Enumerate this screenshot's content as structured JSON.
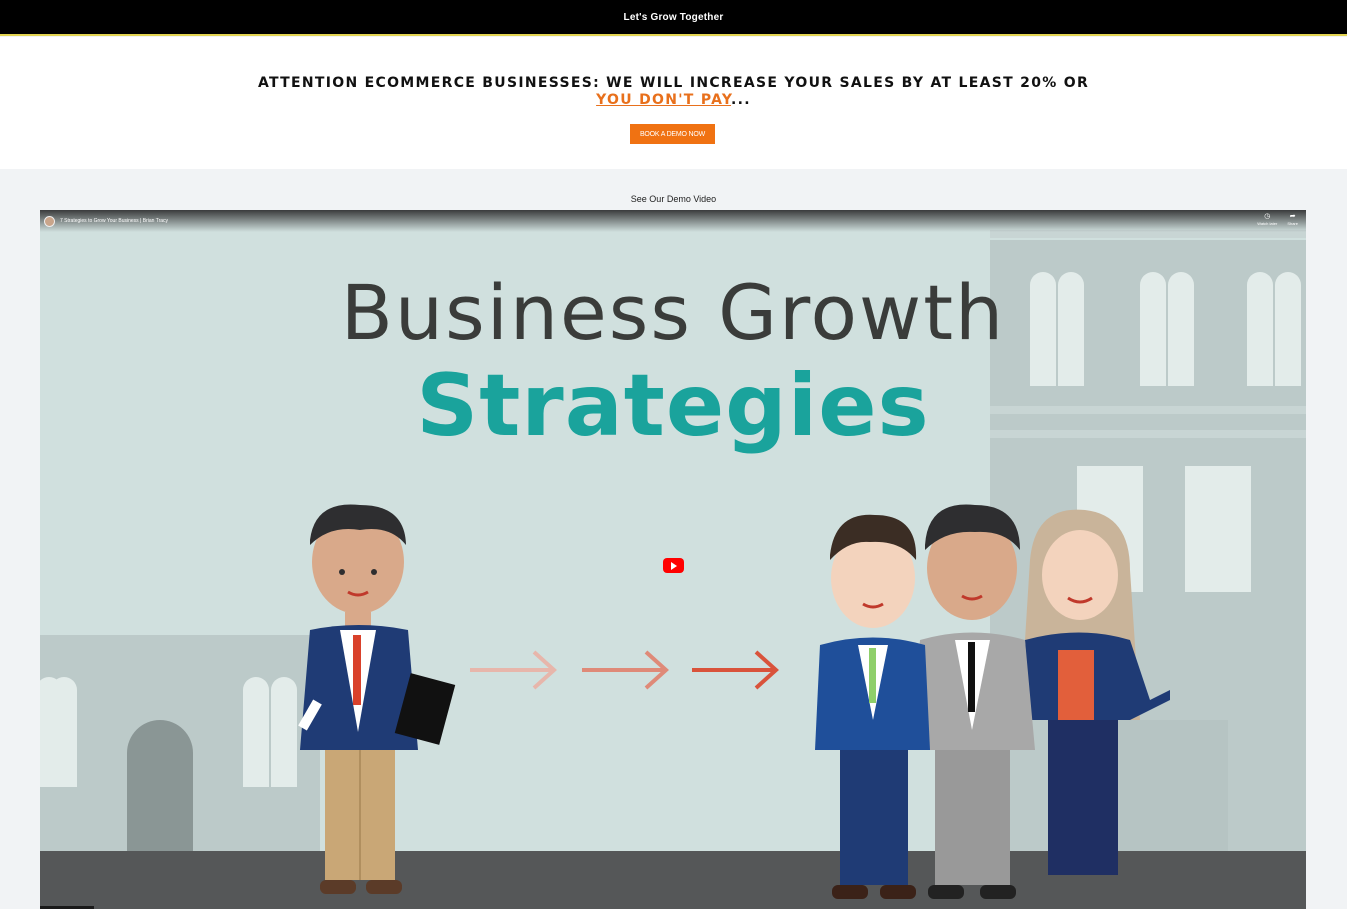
{
  "topbar": {
    "text": "Let's Grow Together"
  },
  "hero": {
    "headline_main": "ATTENTION ECOMMERCE BUSINESSES: WE WILL INCREASE YOUR SALES BY AT LEAST 20% OR",
    "headline_accent": "YOU DON'T PAY",
    "headline_tail": "...",
    "cta_label": "BOOK A DEMO NOW",
    "accent_color": "#f07212"
  },
  "demo": {
    "label": "See Our Demo Video",
    "video_title": "7 Strategies to Grow Your Business | Brian Tracy",
    "watch_later": "Watch later",
    "share": "Share",
    "thumbnail_title": "Business Growth",
    "thumbnail_subtitle": "Strategies",
    "teal_color": "#1aa39c"
  }
}
